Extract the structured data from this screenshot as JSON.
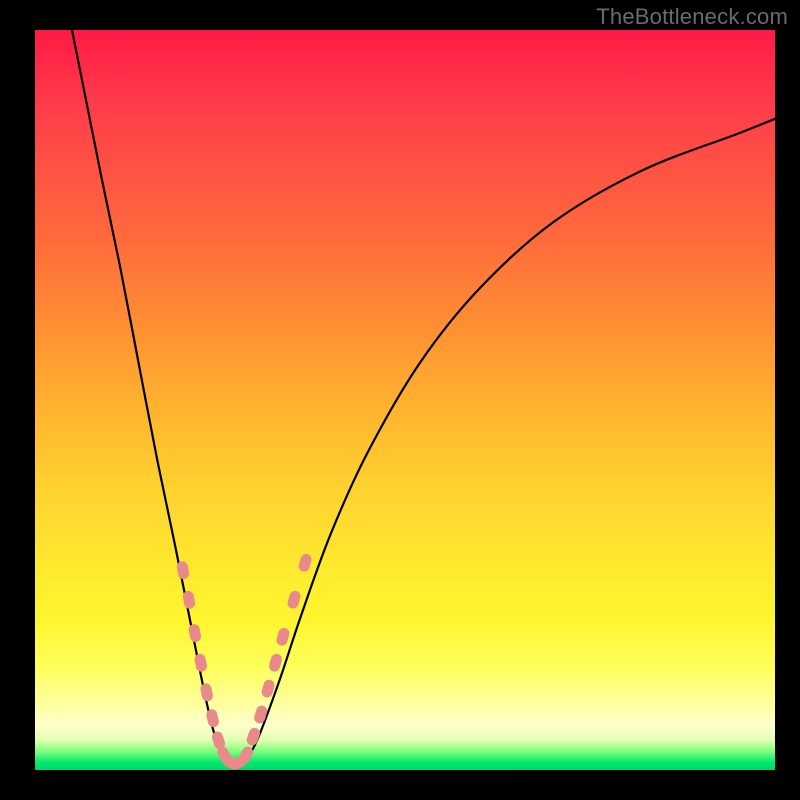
{
  "watermark": "TheBottleneck.com",
  "colors": {
    "curve_stroke": "#000000",
    "marker_fill": "#e98a8a",
    "marker_stroke": "#d97575"
  },
  "chart_data": {
    "type": "line",
    "title": "",
    "xlabel": "",
    "ylabel": "",
    "xlim": [
      0,
      100
    ],
    "ylim": [
      0,
      100
    ],
    "curve_desc": "V-shaped bottleneck curve; left branch descends steeply from top-left, minimum near x≈25 at bottom, right branch rises concavely to upper-right.",
    "curve_points": [
      {
        "x": 5.0,
        "y": 100.0
      },
      {
        "x": 7.0,
        "y": 90.0
      },
      {
        "x": 9.0,
        "y": 80.0
      },
      {
        "x": 11.5,
        "y": 68.0
      },
      {
        "x": 14.0,
        "y": 55.0
      },
      {
        "x": 16.5,
        "y": 42.0
      },
      {
        "x": 19.0,
        "y": 30.0
      },
      {
        "x": 21.0,
        "y": 20.0
      },
      {
        "x": 23.0,
        "y": 10.0
      },
      {
        "x": 24.5,
        "y": 4.0
      },
      {
        "x": 26.0,
        "y": 1.0
      },
      {
        "x": 28.0,
        "y": 1.0
      },
      {
        "x": 30.0,
        "y": 4.0
      },
      {
        "x": 33.0,
        "y": 12.0
      },
      {
        "x": 36.0,
        "y": 21.0
      },
      {
        "x": 40.0,
        "y": 32.0
      },
      {
        "x": 45.0,
        "y": 43.0
      },
      {
        "x": 52.0,
        "y": 55.0
      },
      {
        "x": 60.0,
        "y": 65.0
      },
      {
        "x": 70.0,
        "y": 74.0
      },
      {
        "x": 82.0,
        "y": 81.0
      },
      {
        "x": 95.0,
        "y": 86.0
      },
      {
        "x": 100.0,
        "y": 88.0
      }
    ],
    "markers_desc": "Clustered pink rounded markers along bottom of V where bottleneck is near zero, a few up the lower reaches of both branches.",
    "markers": [
      {
        "x": 20.0,
        "y": 27.0
      },
      {
        "x": 20.8,
        "y": 23.0
      },
      {
        "x": 21.6,
        "y": 18.5
      },
      {
        "x": 22.4,
        "y": 14.5
      },
      {
        "x": 23.2,
        "y": 10.5
      },
      {
        "x": 24.0,
        "y": 7.0
      },
      {
        "x": 24.8,
        "y": 4.0
      },
      {
        "x": 25.6,
        "y": 2.0
      },
      {
        "x": 26.5,
        "y": 1.0
      },
      {
        "x": 27.5,
        "y": 1.0
      },
      {
        "x": 28.5,
        "y": 2.0
      },
      {
        "x": 29.5,
        "y": 4.5
      },
      {
        "x": 30.5,
        "y": 7.5
      },
      {
        "x": 31.5,
        "y": 11.0
      },
      {
        "x": 32.5,
        "y": 14.5
      },
      {
        "x": 33.5,
        "y": 18.0
      },
      {
        "x": 35.0,
        "y": 23.0
      },
      {
        "x": 36.5,
        "y": 28.0
      }
    ]
  }
}
